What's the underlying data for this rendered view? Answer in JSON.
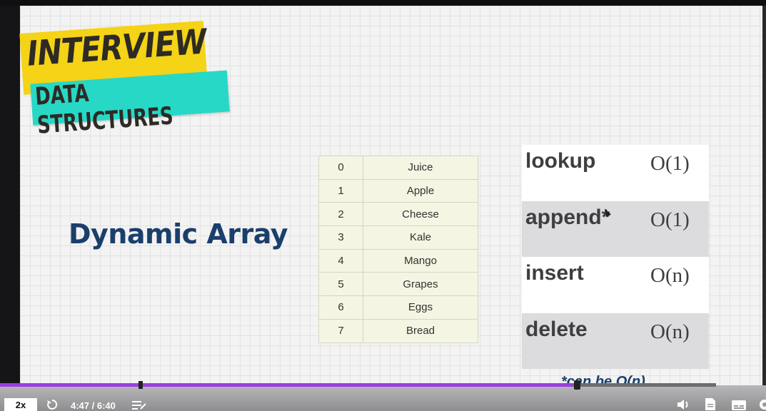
{
  "logo": {
    "line1": "INTERVIEW",
    "line2": "DATA STRUCTURES",
    "color_top": "#f5d316",
    "color_bottom": "#27d8c7"
  },
  "slide": {
    "title": "Dynamic Array",
    "title_color": "#1b3f6b",
    "array": [
      {
        "index": "0",
        "value": "Juice"
      },
      {
        "index": "1",
        "value": "Apple"
      },
      {
        "index": "2",
        "value": "Cheese"
      },
      {
        "index": "3",
        "value": "Kale"
      },
      {
        "index": "4",
        "value": "Mango"
      },
      {
        "index": "5",
        "value": "Grapes"
      },
      {
        "index": "6",
        "value": "Eggs"
      },
      {
        "index": "7",
        "value": "Bread"
      }
    ],
    "complexity": [
      {
        "op": "lookup",
        "big_o": "O(1)"
      },
      {
        "op": "append*",
        "big_o": "O(1)"
      },
      {
        "op": "insert",
        "big_o": "O(n)"
      },
      {
        "op": "delete",
        "big_o": "O(n)"
      }
    ],
    "footnote": "*can be O(n)"
  },
  "player": {
    "speed": "2x",
    "time": "4:47 / 6:40",
    "progress_fraction": 0.8,
    "accent_color": "#9a3ee0",
    "icons": [
      "replay-icon",
      "playlist-icon",
      "volume-icon",
      "transcript-icon",
      "captions-icon",
      "settings-icon"
    ]
  }
}
